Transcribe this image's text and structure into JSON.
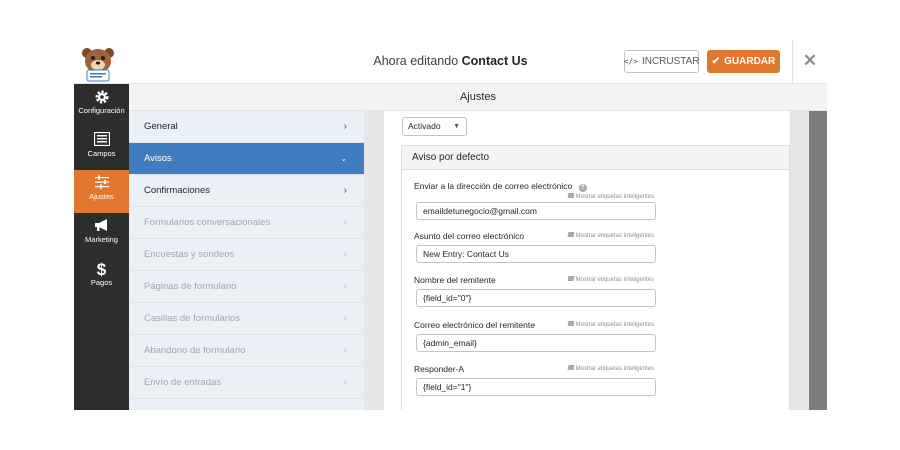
{
  "header": {
    "title_prefix": "Ahora editando",
    "form_name": "Contact Us",
    "embed_label": "INCRUSTAR",
    "save_label": "GUARDAR"
  },
  "nav": {
    "items": [
      {
        "label": "Configuración",
        "icon": "gear-icon"
      },
      {
        "label": "Campos",
        "icon": "fields-list-icon"
      },
      {
        "label": "Ajustes",
        "icon": "sliders-icon"
      },
      {
        "label": "Marketing",
        "icon": "megaphone-icon"
      },
      {
        "label": "Pagos",
        "icon": "dollar-icon"
      }
    ]
  },
  "panel": {
    "title": "Ajustes"
  },
  "menu": {
    "items": [
      {
        "label": "General"
      },
      {
        "label": "Avisos"
      },
      {
        "label": "Confirmaciones"
      },
      {
        "label": "Formularios conversacionales"
      },
      {
        "label": "Encuestas y sondeos"
      },
      {
        "label": "Páginas de formulario"
      },
      {
        "label": "Casillas de formularios"
      },
      {
        "label": "Abandono de formulario"
      },
      {
        "label": "Envío de entradas"
      }
    ]
  },
  "notification": {
    "status": "Activado",
    "box_title": "Aviso por defecto",
    "smart_tags_label": "Mostrar etiquetas inteligentes",
    "fields": [
      {
        "label": "Enviar a la dirección de correo electrónico",
        "value": "emaildetunegocio@gmail.com"
      },
      {
        "label": "Asunto del correo electrónico",
        "value": "New Entry: Contact Us"
      },
      {
        "label": "Nombre del remitente",
        "value": "{field_id=\"0\"}"
      },
      {
        "label": "Correo electrónico del remitente",
        "value": "{admin_email}"
      },
      {
        "label": "Responder-A",
        "value": "{field_id=\"1\"}"
      }
    ]
  },
  "colors": {
    "accent_orange": "#e27730",
    "active_blue": "#3f7cc0",
    "nav_dark": "#2d2d2d"
  }
}
